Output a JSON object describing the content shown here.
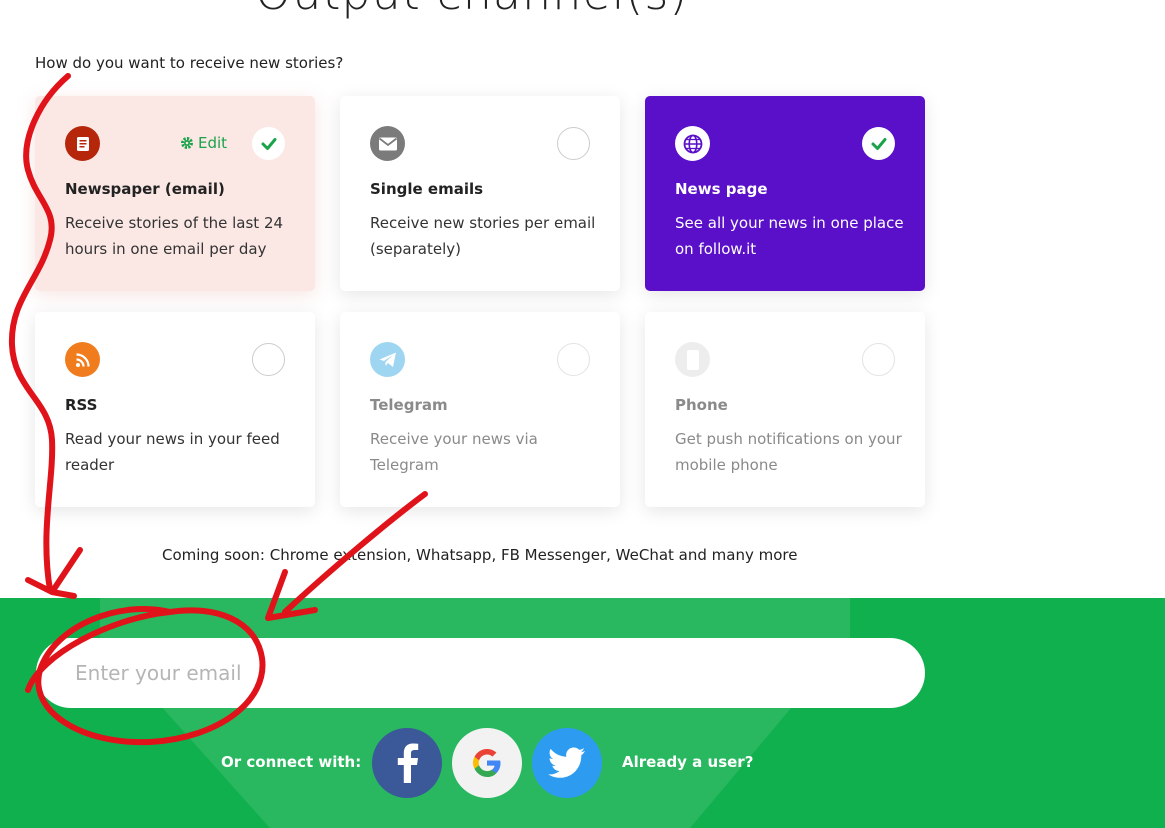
{
  "header": {
    "title": "Output channel(s)",
    "question": "How do you want to receive new stories?"
  },
  "cards": [
    {
      "title": "Newspaper (email)",
      "desc": "Receive stories of the last 24 hours in one email per day",
      "selected": true,
      "edit_label": "Edit",
      "icon": "newspaper-icon"
    },
    {
      "title": "Single emails",
      "desc": "Receive new stories per email (separately)",
      "selected": false,
      "icon": "envelope-icon"
    },
    {
      "title": "News page",
      "desc": "See all your news in one place on follow.it",
      "selected": true,
      "icon": "globe-icon"
    },
    {
      "title": "RSS",
      "desc": "Read your news in your feed reader",
      "selected": false,
      "icon": "rss-icon"
    },
    {
      "title": "Telegram",
      "desc": "Receive your news via Telegram",
      "selected": false,
      "icon": "telegram-icon"
    },
    {
      "title": "Phone",
      "desc": "Get push notifications on your mobile phone",
      "selected": false,
      "icon": "phone-icon"
    }
  ],
  "coming_soon": "Coming soon: Chrome extension, Whatsapp, FB Messenger, WeChat and many more",
  "signup": {
    "email_placeholder": "Enter your email",
    "connect_label": "Or connect with:",
    "already_user": "Already a user?"
  },
  "colors": {
    "green": "#11b04f",
    "purple": "#5a0fc8",
    "pink": "#fbe8e5",
    "annotation_red": "#e0131a",
    "check_green": "#1aa34a"
  }
}
